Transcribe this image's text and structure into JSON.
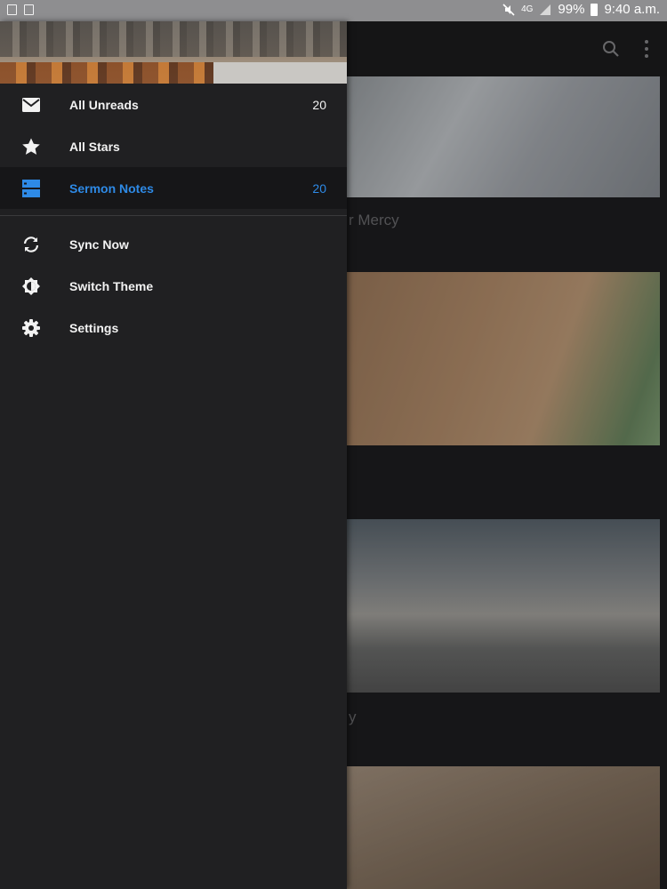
{
  "status_bar": {
    "network": "4G",
    "battery": "99%",
    "time": "9:40 a.m."
  },
  "background": {
    "card_titles": [
      "r Mercy",
      "y"
    ]
  },
  "drawer": {
    "feeds": [
      {
        "label": "All Unreads",
        "count": "20",
        "icon": "mail-icon"
      },
      {
        "label": "All Stars",
        "count": "",
        "icon": "star-icon"
      },
      {
        "label": "Sermon Notes",
        "count": "20",
        "icon": "folder-icon",
        "active": true
      }
    ],
    "actions": [
      {
        "label": "Sync Now",
        "icon": "sync-icon"
      },
      {
        "label": "Switch Theme",
        "icon": "theme-icon"
      },
      {
        "label": "Settings",
        "icon": "settings-icon"
      }
    ]
  },
  "colors": {
    "accent": "#2e8ae6",
    "drawer_bg": "#202022",
    "active_row_bg": "#161618"
  }
}
